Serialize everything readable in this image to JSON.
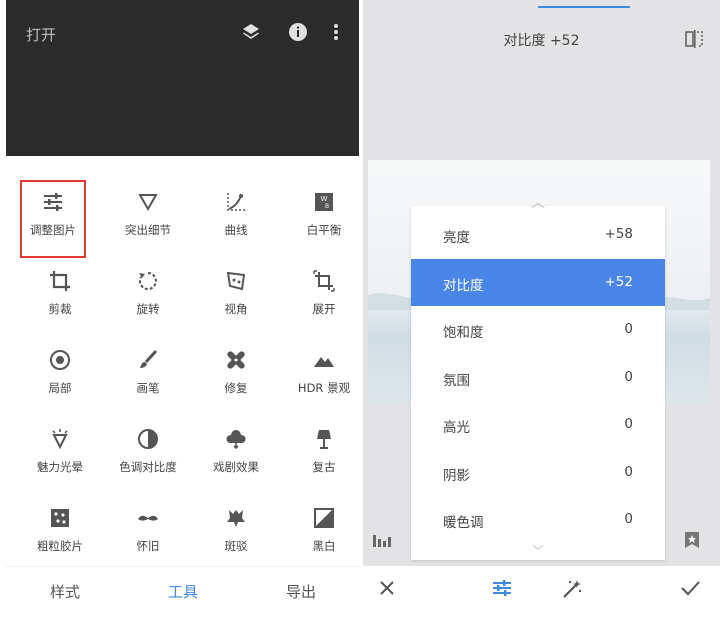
{
  "left": {
    "top_bar": {
      "open_label": "打开",
      "icons": [
        "layers-icon",
        "info-icon",
        "more-vert-icon"
      ]
    },
    "tools": [
      {
        "label": "调整图片",
        "icon": "tune-icon",
        "selected": true
      },
      {
        "label": "突出细节",
        "icon": "details-triangle-icon"
      },
      {
        "label": "曲线",
        "icon": "curves-icon"
      },
      {
        "label": "白平衡",
        "icon": "white-balance-icon"
      },
      {
        "label": "剪裁",
        "icon": "crop-icon"
      },
      {
        "label": "旋转",
        "icon": "rotate-icon"
      },
      {
        "label": "视角",
        "icon": "perspective-icon"
      },
      {
        "label": "展开",
        "icon": "expand-icon"
      },
      {
        "label": "局部",
        "icon": "selective-icon"
      },
      {
        "label": "画笔",
        "icon": "brush-icon"
      },
      {
        "label": "修复",
        "icon": "healing-icon"
      },
      {
        "label": "HDR 景观",
        "icon": "hdr-mountain-icon"
      },
      {
        "label": "魅力光晕",
        "icon": "glamour-glow-icon"
      },
      {
        "label": "色调对比度",
        "icon": "tonal-contrast-icon"
      },
      {
        "label": "戏剧效果",
        "icon": "drama-cloud-icon"
      },
      {
        "label": "复古",
        "icon": "vintage-lamp-icon"
      },
      {
        "label": "粗粒胶片",
        "icon": "grainy-film-icon"
      },
      {
        "label": "怀旧",
        "icon": "retrolux-mustache-icon"
      },
      {
        "label": "斑驳",
        "icon": "grunge-icon"
      },
      {
        "label": "黑白",
        "icon": "black-white-icon"
      }
    ],
    "bottom_tabs": [
      {
        "label": "样式",
        "active": false
      },
      {
        "label": "工具",
        "active": true
      },
      {
        "label": "导出",
        "active": false
      }
    ]
  },
  "right": {
    "title": "对比度 +52",
    "adjustments": [
      {
        "name": "亮度",
        "value": "+58",
        "selected": false
      },
      {
        "name": "对比度",
        "value": "+52",
        "selected": true
      },
      {
        "name": "饱和度",
        "value": "0",
        "selected": false
      },
      {
        "name": "氛围",
        "value": "0",
        "selected": false
      },
      {
        "name": "高光",
        "value": "0",
        "selected": false
      },
      {
        "name": "阴影",
        "value": "0",
        "selected": false
      },
      {
        "name": "暖色调",
        "value": "0",
        "selected": false
      }
    ],
    "bottom_icons": [
      "close-icon",
      "tune-icon",
      "auto-magic-icon",
      "check-icon"
    ]
  },
  "colors": {
    "accent": "#3f8ae0",
    "highlight": "#4a86e8",
    "selection_border": "#e53935",
    "top_bar": "#2b2b2b"
  }
}
